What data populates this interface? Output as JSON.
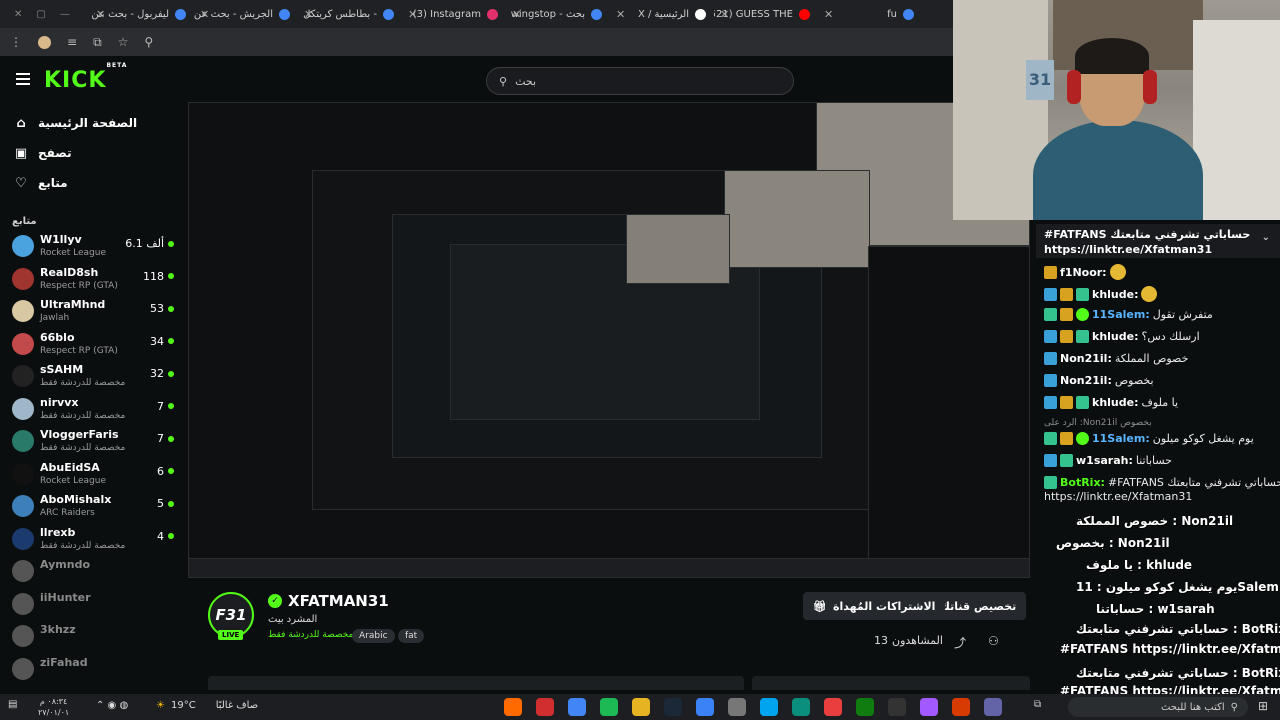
{
  "browser": {
    "tabs": [
      {
        "label": "ليفربول - بحث عن",
        "color": "#4285f4"
      },
      {
        "label": "الجريش - بحث عن",
        "color": "#4285f4"
      },
      {
        "label": "بطاطس كريتكل -",
        "color": "#4285f4"
      },
      {
        "label": "(3) Instagram",
        "color": "#e1306c"
      },
      {
        "label": "wingstop - بحث",
        "color": "#4285f4"
      },
      {
        "label": "X / الرئيسية",
        "color": "#ffffff"
      },
      {
        "label": "(521) GUESS THE",
        "color": "#ff0000"
      },
      {
        "label": "fu",
        "color": "#4285f4"
      }
    ]
  },
  "header": {
    "logo": "KICK",
    "logo_sup": "BETA",
    "search_placeholder": "بحث"
  },
  "sidebar": {
    "nav": [
      {
        "label": "الصفحة الرئيسية",
        "icon": "home-icon",
        "glyph": "⌂"
      },
      {
        "label": "تصفح",
        "icon": "browse-icon",
        "glyph": "▣"
      },
      {
        "label": "متابع",
        "icon": "heart-icon",
        "glyph": "♡"
      }
    ],
    "section_title": "متابع",
    "channels": [
      {
        "name": "W1llyv",
        "game": "Rocket League",
        "viewers": "6.1 ألف",
        "color": "#4aa3df",
        "live": true
      },
      {
        "name": "RealD8sh",
        "game": "Respect RP (GTA)",
        "viewers": "118",
        "color": "#a0342f",
        "live": true
      },
      {
        "name": "UltraMhnd",
        "game": "Jawlah",
        "viewers": "53",
        "color": "#d9c9a3",
        "live": true
      },
      {
        "name": "66blo",
        "game": "Respect RP (GTA)",
        "viewers": "34",
        "color": "#c24a4a",
        "live": true
      },
      {
        "name": "sSAHM",
        "game": "مخصصة للدردشة فقط",
        "viewers": "32",
        "color": "#222222",
        "live": true
      },
      {
        "name": "nirvvx",
        "game": "مخصصة للدردشة فقط",
        "viewers": "7",
        "color": "#9fb7c9",
        "live": true
      },
      {
        "name": "VloggerFaris",
        "game": "مخصصة للدردشة فقط",
        "viewers": "7",
        "color": "#2a7a6a",
        "live": true
      },
      {
        "name": "AbuEidSA",
        "game": "Rocket League",
        "viewers": "6",
        "color": "#111111",
        "live": true
      },
      {
        "name": "AboMishalx",
        "game": "ARC Raiders",
        "viewers": "5",
        "color": "#3d7fb8",
        "live": true
      },
      {
        "name": "llrexb",
        "game": "مخصصة للدردشة فقط",
        "viewers": "4",
        "color": "#1b3b6f",
        "live": true
      },
      {
        "name": "Aymndo",
        "game": "",
        "viewers": "",
        "color": "#555555",
        "live": false
      },
      {
        "name": "iiHunter",
        "game": "",
        "viewers": "",
        "color": "#555555",
        "live": false
      },
      {
        "name": "3khzz",
        "game": "",
        "viewers": "",
        "color": "#555555",
        "live": false
      },
      {
        "name": "ziFahad",
        "game": "",
        "viewers": "",
        "color": "#555555",
        "live": false
      }
    ]
  },
  "stream": {
    "streamer": "XFATMAN31",
    "avatar_text": "F31",
    "live_label": "LIVE",
    "title": "المشرد بيث",
    "category": "مخصصة للدردشة فقط",
    "tags": [
      "Arabic",
      "fat"
    ],
    "customize_button": "تخصيص قناتك",
    "gift_button": "الاشتراكات المُهداة",
    "viewers_label": "المشاهدون",
    "viewers_count": "13"
  },
  "chat": {
    "pinned_line1": "#FATFANS حساباتي تشرفني متابعتك",
    "pinned_line2": "https://linktr.ee/Xfatman31",
    "messages": [
      {
        "user": "f1Noor:",
        "text": "",
        "emoji": true,
        "color": "#ffffff",
        "badges": [
          "b-gold"
        ]
      },
      {
        "user": "khlude:",
        "text": "",
        "emoji": true,
        "color": "#ffffff",
        "badges": [
          "b-blue",
          "b-gold",
          "b-green"
        ]
      },
      {
        "user": "11Salem:",
        "text": "متفرش تقول",
        "emoji": false,
        "color": "#5ab4ff",
        "badges": [
          "b-green",
          "b-gold",
          "b-sub"
        ]
      },
      {
        "user": "khlude:",
        "text": "ارسلك دس؟",
        "emoji": false,
        "color": "#ffffff",
        "badges": [
          "b-blue",
          "b-gold",
          "b-green"
        ]
      },
      {
        "user": "Non21il:",
        "text": "خصوص المملكة",
        "emoji": false,
        "color": "#ffffff",
        "badges": [
          "b-blue"
        ]
      },
      {
        "user": "Non21il:",
        "text": "بخصوص",
        "emoji": false,
        "color": "#ffffff",
        "badges": [
          "b-blue"
        ]
      },
      {
        "user": "khlude:",
        "text": "يا ملوف",
        "emoji": false,
        "color": "#ffffff",
        "badges": [
          "b-blue",
          "b-gold",
          "b-green"
        ]
      },
      {
        "user": "11Salem:",
        "text": "يوم يشغل كوكو ميلون",
        "emoji": false,
        "color": "#5ab4ff",
        "badges": [
          "b-green",
          "b-gold",
          "b-sub"
        ]
      },
      {
        "user": "w1sarah:",
        "text": "حساباتنا",
        "emoji": false,
        "color": "#ffffff",
        "badges": [
          "b-blue",
          "b-green"
        ]
      },
      {
        "user": "BotRix:",
        "text": "#FATFANS حساباتي تشرفني متابعتك",
        "emoji": false,
        "color": "#53fc18",
        "badges": [
          "b-green"
        ]
      }
    ],
    "reply_text": "الرد على :Non21il بخصوص",
    "bot_link": "https://linktr.ee/Xfatman31",
    "overlay": [
      "خصوص المملكة : Non21il",
      "بخصوص : Non21il",
      "يا ملوف : khlude",
      "يوم يشغل كوكو ميلون : 11Salem",
      "حساباتنا : w1sarah",
      "حساباتي تشرفني متابعتك : BotRix",
      "#FATFANS https://linktr.ee/Xfatman31",
      "حساباتي تشرفني متابعتك : BotRix",
      "#FATFANS https://linktr.ee/Xfatman31"
    ]
  },
  "taskbar": {
    "time": "٠٨:٣٤ م",
    "date": "٢٧/٠١/٠١",
    "weather": "صاف غالبًا",
    "temp": "19°C",
    "search_placeholder": "اكتب هنا للبحث",
    "apps": [
      "#ff6a00",
      "#d12f2f",
      "#4285f4",
      "#1db954",
      "#e6b422",
      "#1b2838",
      "#3b82f6",
      "#777777",
      "#00a4ef",
      "#0a8f7c",
      "#e83e3e",
      "#107c10",
      "#333333",
      "#a259ff",
      "#d83b01",
      "#6264a7"
    ]
  }
}
